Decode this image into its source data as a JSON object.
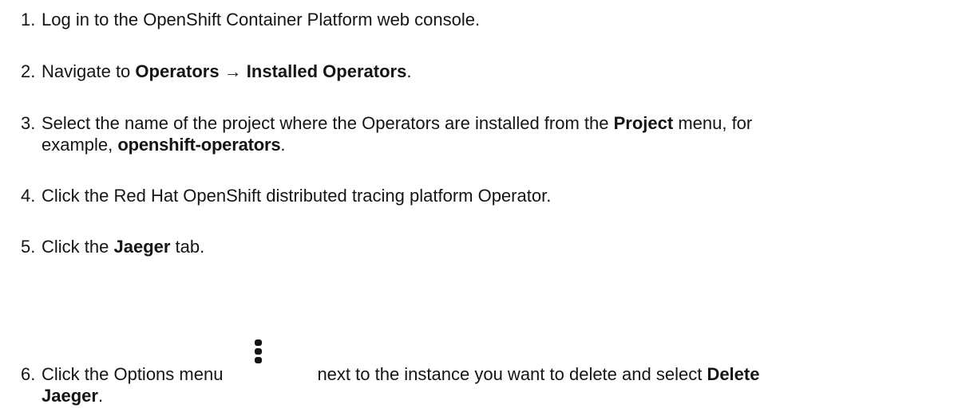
{
  "steps": [
    {
      "num": "1.",
      "text": "Log in to the OpenShift Container Platform web console."
    },
    {
      "num": "2.",
      "pre": "Navigate to ",
      "b1": "Operators",
      "arrow": " → ",
      "b2": "Installed Operators",
      "post": "."
    },
    {
      "num": "3.",
      "pre": "Select the name of the project where the Operators are installed from the ",
      "b1": "Project",
      "mid": " menu, for",
      "line2_pre": "example, ",
      "b2": "openshift-operators",
      "post": "."
    },
    {
      "num": "4.",
      "text": "Click the Red Hat OpenShift distributed tracing platform Operator."
    },
    {
      "num": "5.",
      "pre": "Click the ",
      "b1": "Jaeger",
      "post": " tab."
    },
    {
      "num": "6.",
      "pre": "Click the Options menu",
      "mid": "next to the instance you want to delete and select ",
      "b1": "Delete",
      "b2": "Jaeger",
      "post": ".",
      "icon": "kebab-menu-icon"
    }
  ]
}
